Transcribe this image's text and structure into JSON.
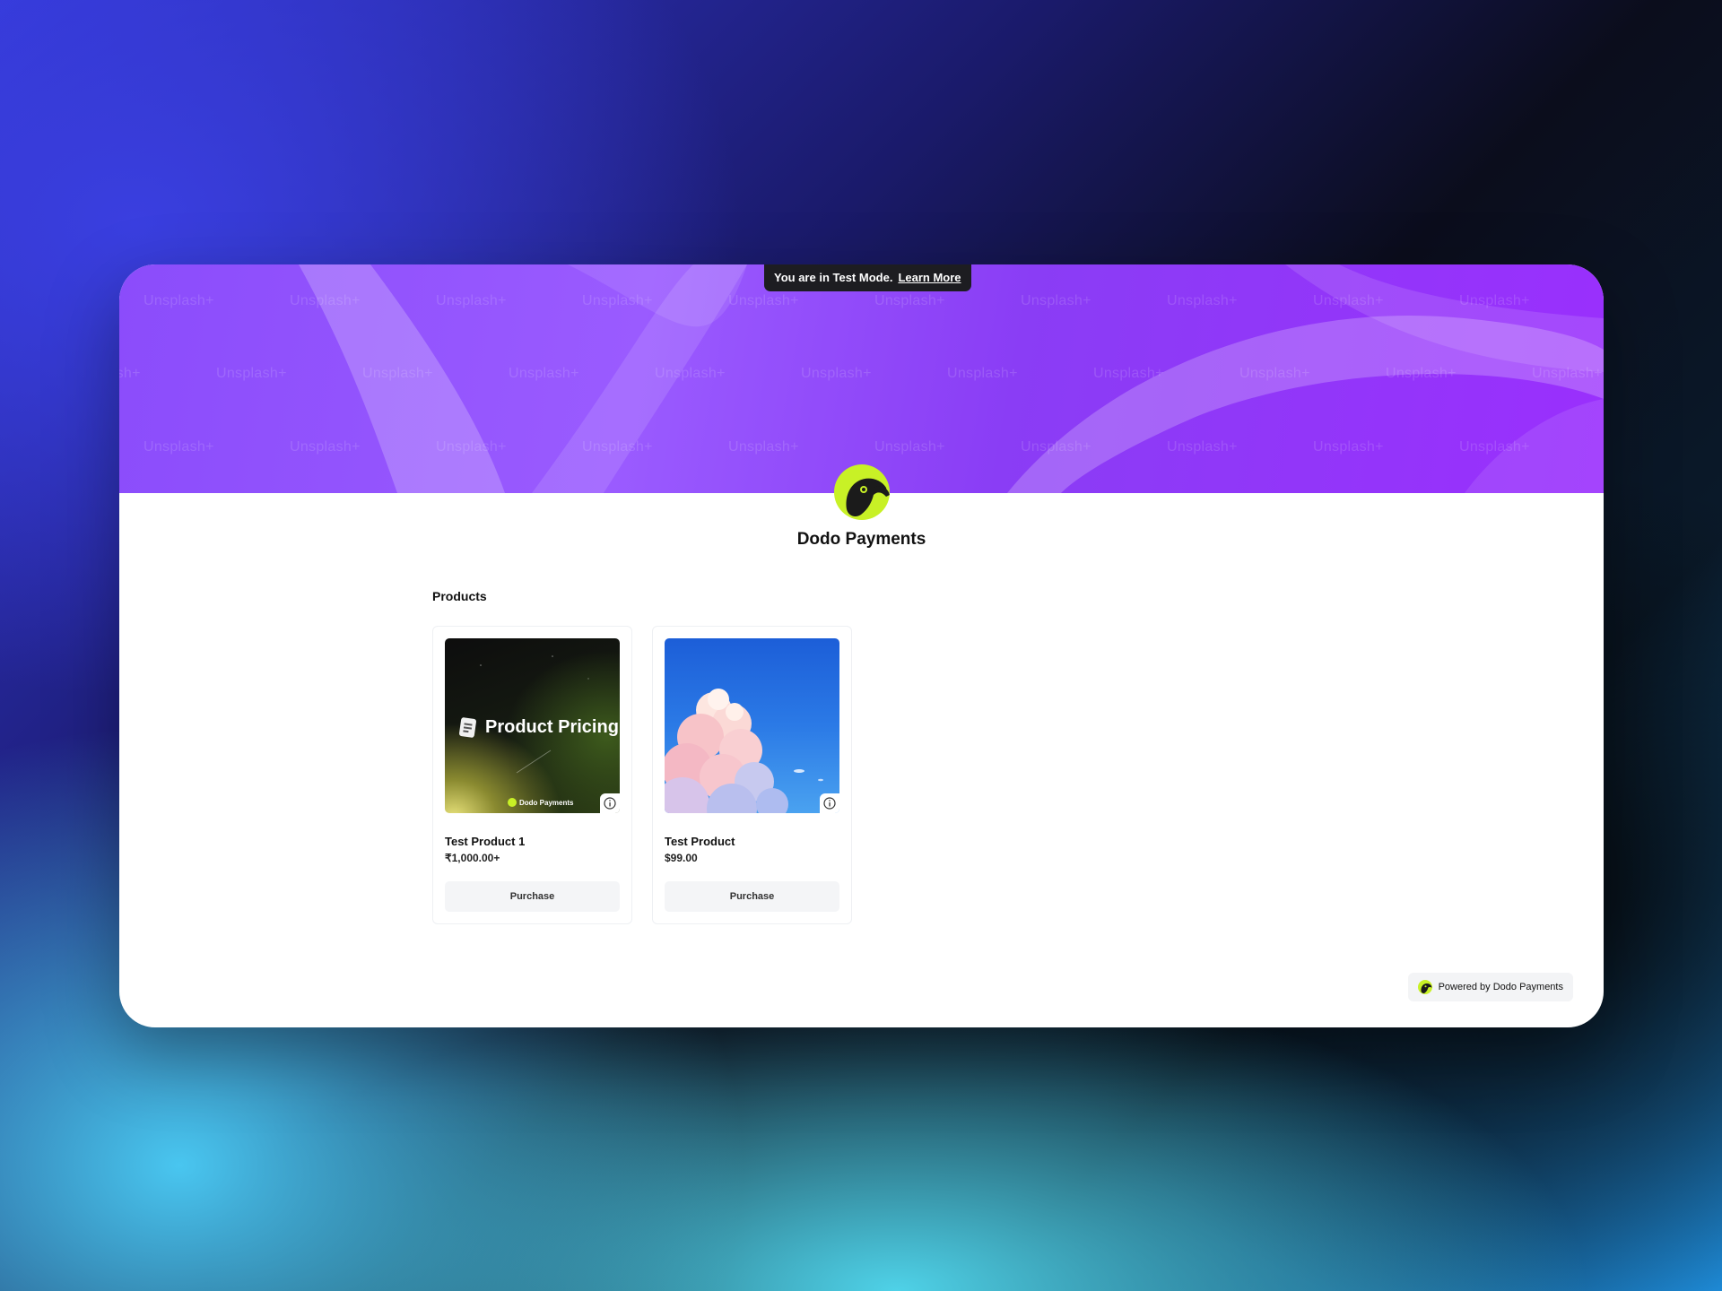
{
  "test_mode": {
    "message": "You are in Test Mode.",
    "link_label": "Learn More"
  },
  "banner": {
    "watermark_text": "Unsplash+"
  },
  "brand": {
    "name": "Dodo Payments",
    "accent_color": "#c8f126"
  },
  "products_section": {
    "title": "Products",
    "items": [
      {
        "name": "Test Product 1",
        "price": "₹1,000.00+",
        "image_caption": "Product Pricing",
        "image_brand": "Dodo Payments",
        "button_label": "Purchase",
        "info_icon": "info-circle-icon"
      },
      {
        "name": "Test Product",
        "price": "$99.00",
        "button_label": "Purchase",
        "info_icon": "info-circle-icon"
      }
    ]
  },
  "footer": {
    "powered_by": "Powered by Dodo Payments"
  }
}
